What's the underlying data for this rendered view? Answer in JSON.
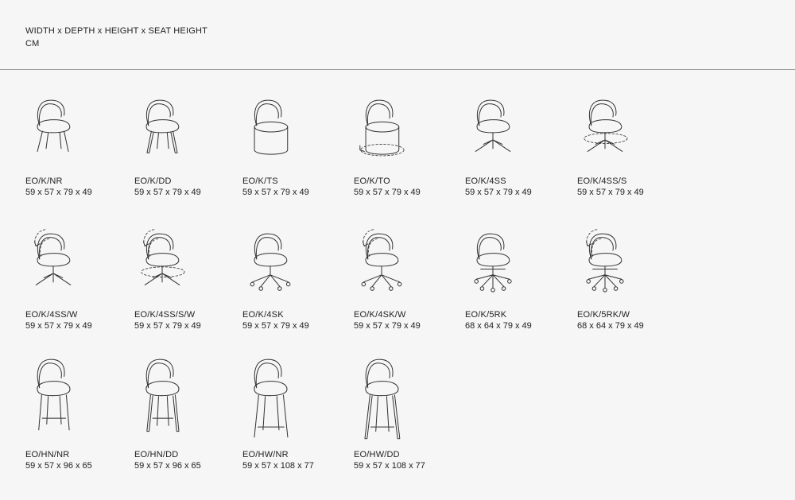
{
  "header": {
    "dimensions_label": "WIDTH x DEPTH x HEIGHT x SEAT HEIGHT",
    "unit": "CM"
  },
  "models": [
    {
      "code": "EO/K/NR",
      "dims": "59 x 57 x 79 x 49",
      "icon": "chair-4-leg-icon"
    },
    {
      "code": "EO/K/DD",
      "dims": "59 x 57 x 79 x 49",
      "icon": "chair-4-wood-leg-icon"
    },
    {
      "code": "EO/K/TS",
      "dims": "59 x 57 x 79 x 49",
      "icon": "chair-pedestal-icon"
    },
    {
      "code": "EO/K/TO",
      "dims": "59 x 57 x 79 x 49",
      "icon": "chair-pedestal-swivel-icon"
    },
    {
      "code": "EO/K/4SS",
      "dims": "59 x 57 x 79 x 49",
      "icon": "chair-4-star-icon"
    },
    {
      "code": "EO/K/4SS/S",
      "dims": "59 x 57 x 79 x 49",
      "icon": "chair-4-star-swivel-icon"
    },
    {
      "code": "EO/K/4SS/W",
      "dims": "59 x 57 x 79 x 49",
      "icon": "chair-4-star-tilt-icon"
    },
    {
      "code": "EO/K/4SS/S/W",
      "dims": "59 x 57 x 79 x 49",
      "icon": "chair-4-star-swivel-tilt-icon"
    },
    {
      "code": "EO/K/4SK",
      "dims": "59 x 57 x 79 x 49",
      "icon": "chair-4-caster-icon"
    },
    {
      "code": "EO/K/4SK/W",
      "dims": "59 x 57 x 79 x 49",
      "icon": "chair-4-caster-tilt-icon"
    },
    {
      "code": "EO/K/5RK",
      "dims": "68 x 64 x 79 x 49",
      "icon": "chair-5-caster-icon"
    },
    {
      "code": "EO/K/5RK/W",
      "dims": "68 x 64 x 79 x 49",
      "icon": "chair-5-caster-tilt-icon"
    },
    {
      "code": "EO/HN/NR",
      "dims": "59 x 57 x 96 x 65",
      "icon": "counter-stool-icon"
    },
    {
      "code": "EO/HN/DD",
      "dims": "59 x 57 x 96 x 65",
      "icon": "counter-stool-wood-icon"
    },
    {
      "code": "EO/HW/NR",
      "dims": "59 x 57 x 108 x 77",
      "icon": "bar-stool-icon"
    },
    {
      "code": "EO/HW/DD",
      "dims": "59 x 57 x 108 x 77",
      "icon": "bar-stool-wood-icon"
    }
  ]
}
